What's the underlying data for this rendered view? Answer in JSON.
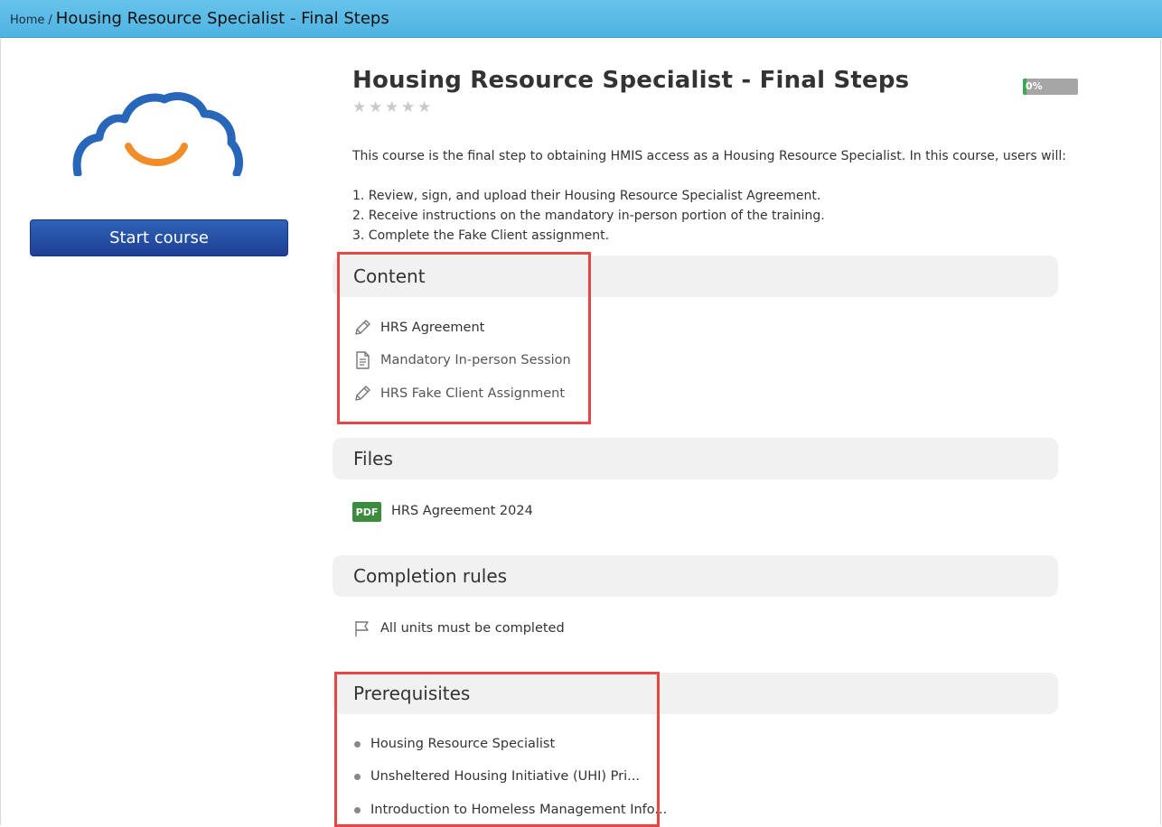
{
  "breadcrumb": {
    "home": "Home",
    "separator": "/",
    "current": "Housing Resource Specialist - Final Steps"
  },
  "course": {
    "title": "Housing Resource Specialist - Final Steps",
    "rating_stars": 5,
    "rating_value": 0,
    "progress_label": "0%",
    "progress_value": 0,
    "start_button": "Start course",
    "description_intro": "This course is the final step to obtaining HMIS access as a Housing Resource Specialist. In this course, users will:",
    "description_steps": [
      "1. Review, sign, and upload their Housing Resource Specialist Agreement.",
      "2. Receive instructions on the mandatory in-person portion of the training.",
      "3. Complete the Fake Client assignment."
    ]
  },
  "sections": {
    "content_title": "Content",
    "files_title": "Files",
    "completion_title": "Completion rules",
    "prereq_title": "Prerequisites"
  },
  "content_units": [
    {
      "label": "HRS Agreement",
      "icon": "pencil-icon"
    },
    {
      "label": "Mandatory In-person Session",
      "icon": "document-icon"
    },
    {
      "label": "HRS Fake Client Assignment",
      "icon": "pencil-icon"
    }
  ],
  "files": [
    {
      "badge": "PDF",
      "name": "HRS Agreement 2024"
    }
  ],
  "completion_rules": [
    {
      "label": "All units must be completed",
      "icon": "flag-icon"
    }
  ],
  "prerequisites": [
    "Housing Resource Specialist",
    "Unsheltered Housing Initiative (UHI) Pri...",
    "Introduction to Homeless Management Info..."
  ],
  "colors": {
    "topbar": "#5bbbe6",
    "start_button": "#2a55aa",
    "pdf_badge": "#3d8b3d",
    "highlight": "#e84545",
    "logo_blue": "#2766b8",
    "logo_orange": "#f28c28"
  }
}
